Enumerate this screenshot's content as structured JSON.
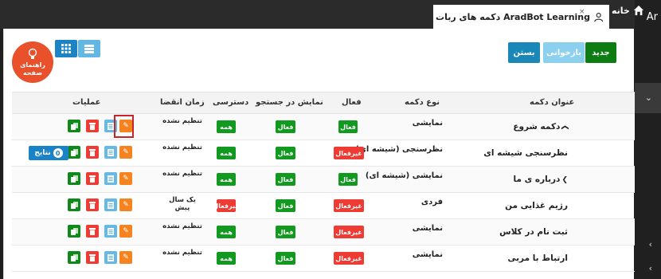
{
  "app": {
    "ar_label": "Ar"
  },
  "tabs": {
    "home_label": "خانه",
    "active_label": "دکمه های ربات AradBot Learning",
    "close_glyph": "×"
  },
  "help": {
    "line1": "راهنمای",
    "line2": "صفحه"
  },
  "toolbar": {
    "new": "جدید",
    "reload": "بازخوانی",
    "close": "بستن"
  },
  "table": {
    "headers": {
      "title": "عنوان دکمه",
      "type": "نوع دکمه",
      "active": "فعال",
      "search_display": "نمایش در جستجو",
      "access": "دسترسی",
      "expire": "زمان انقضا",
      "operations": "عملیات"
    },
    "rows": [
      {
        "title": "دکمه شروع",
        "chevron": "❯",
        "type": "نمایشی",
        "active": "فعال",
        "active_state": "on",
        "search": "فعال",
        "access": "همه",
        "expire": "تنظیم نشده"
      },
      {
        "title": "نظرسنجی شیشه ای",
        "chevron": "",
        "type": "نظرسنجی (شیشه ای)",
        "active": "غیرفعال",
        "active_state": "off",
        "search": "فعال",
        "access": "همه",
        "expire": "تنظیم نشده",
        "results_label": "نتایج",
        "results_count": "0"
      },
      {
        "title": "درباره ی ما",
        "chevron": "❯",
        "type": "نمایشی (شیشه ای)",
        "active": "فعال",
        "active_state": "on",
        "search": "فعال",
        "access": "همه",
        "expire": "تنظیم نشده"
      },
      {
        "title": "رژیم غذایی من",
        "chevron": "",
        "type": "فردی",
        "active": "غیرفعال",
        "active_state": "off",
        "search": "فعال",
        "access": "غیرفعال",
        "expire": "یک سال پیش"
      },
      {
        "title": "ثبت نام در کلاس",
        "chevron": "",
        "type": "نمایشی",
        "active": "غیرفعال",
        "active_state": "off",
        "search": "فعال",
        "access": "همه",
        "expire": "تنظیم نشده"
      },
      {
        "title": "ارتباط با مربی",
        "chevron": "",
        "type": "نمایشی",
        "active": "غیرفعال",
        "active_state": "off",
        "search": "فعال",
        "access": "همه",
        "expire": "تنظیم نشده"
      }
    ]
  },
  "colors": {
    "green": "#119a1f",
    "red": "#ee3b33",
    "orange": "#f58320",
    "blue": "#1a84c6",
    "light_blue": "#64b9e6",
    "help": "#e8512b"
  },
  "icons": [
    "home-icon",
    "user-icon",
    "lightbulb-icon",
    "grid-icon",
    "list-icon",
    "edit-icon",
    "info-icon",
    "delete-icon",
    "copy-icon",
    "chevron-down-icon",
    "chevron-right-icon"
  ]
}
